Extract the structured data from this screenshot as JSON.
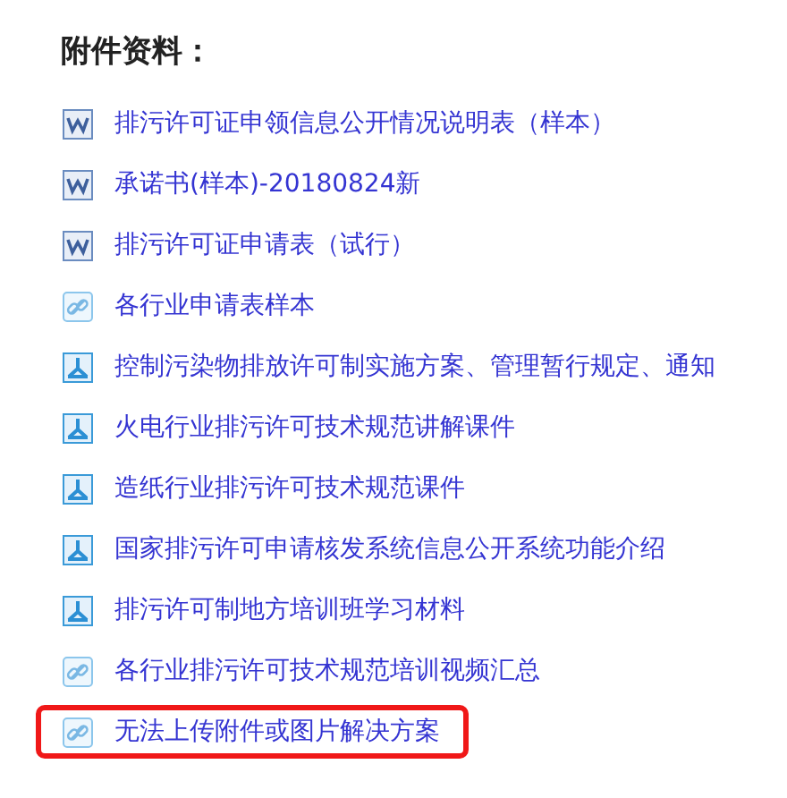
{
  "title": "附件资料：",
  "items": [
    {
      "kind": "word",
      "label": "排污许可证申领信息公开情况说明表（样本）",
      "highlighted": false
    },
    {
      "kind": "word",
      "label": "承诺书(样本)-20180824新",
      "highlighted": false
    },
    {
      "kind": "word",
      "label": "排污许可证申请表（试行）",
      "highlighted": false
    },
    {
      "kind": "link",
      "label": "各行业申请表样本",
      "highlighted": false
    },
    {
      "kind": "pdf",
      "label": "控制污染物排放许可制实施方案、管理暂行规定、通知",
      "highlighted": false
    },
    {
      "kind": "pdf",
      "label": "火电行业排污许可技术规范讲解课件",
      "highlighted": false
    },
    {
      "kind": "pdf",
      "label": "造纸行业排污许可技术规范课件",
      "highlighted": false
    },
    {
      "kind": "pdf",
      "label": "国家排污许可申请核发系统信息公开系统功能介绍",
      "highlighted": false
    },
    {
      "kind": "pdf",
      "label": "排污许可制地方培训班学习材料",
      "highlighted": false
    },
    {
      "kind": "link",
      "label": "各行业排污许可技术规范培训视频汇总",
      "highlighted": false
    },
    {
      "kind": "link",
      "label": "无法上传附件或图片解决方案",
      "highlighted": true
    }
  ]
}
